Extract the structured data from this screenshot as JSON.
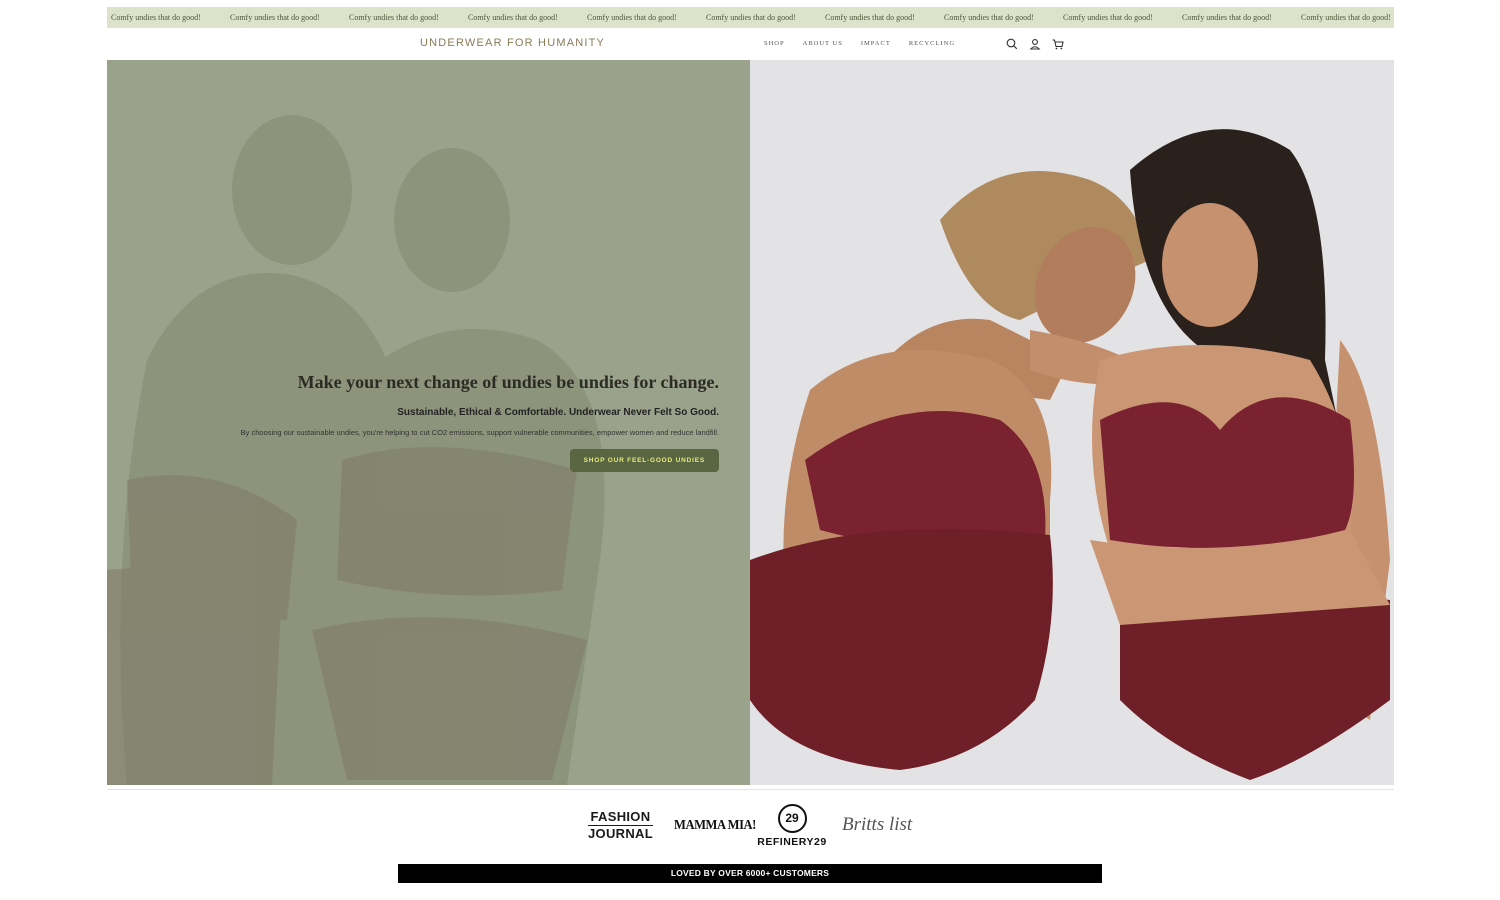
{
  "announcement": {
    "messages": [
      "Comfy undies that do good!",
      "Comfy undies that do good!",
      "Comfy undies that do good!",
      "Comfy undies that do good!",
      "Comfy undies that do good!",
      "Comfy undies that do good!",
      "Comfy undies that do good!",
      "Comfy undies that do good!",
      "Comfy undies that do good!",
      "Comfy undies that do good!",
      "Comfy undies that do good!"
    ],
    "bg_color": "#dde3cb"
  },
  "header": {
    "logo": "UNDERWEAR FOR HUMANITY",
    "nav": [
      "SHOP",
      "ABOUT US",
      "IMPACT",
      "RECYCLING"
    ],
    "icons": [
      "search-icon",
      "account-icon",
      "cart-icon"
    ]
  },
  "hero": {
    "title": "Make your next change of undies be undies for change.",
    "subtitle": "Sustainable, Ethical & Comfortable. Underwear Never Felt So Good.",
    "body": "By choosing our sustainable undies, you're helping to cut CO2 emissions, support vulnerable communities, empower women and reduce landfill.",
    "cta": "SHOP OUR FEEL-GOOD UNDIES",
    "overlay_color": "#9ba28c",
    "cta_color": "#5a6541",
    "garment_color": "#6e1f28"
  },
  "press": {
    "logos": [
      {
        "name": "fashion-journal-logo",
        "line1": "FASHION",
        "line2": "JOURNAL"
      },
      {
        "name": "mamma-mia-logo",
        "text": "MAMMA MIA!"
      },
      {
        "name": "refinery29-logo",
        "mark": "29",
        "text": "REFINERY29"
      },
      {
        "name": "britts-list-logo",
        "text": "Britts list"
      }
    ]
  },
  "banner": {
    "text": "LOVED BY OVER 6000+ CUSTOMERS"
  }
}
